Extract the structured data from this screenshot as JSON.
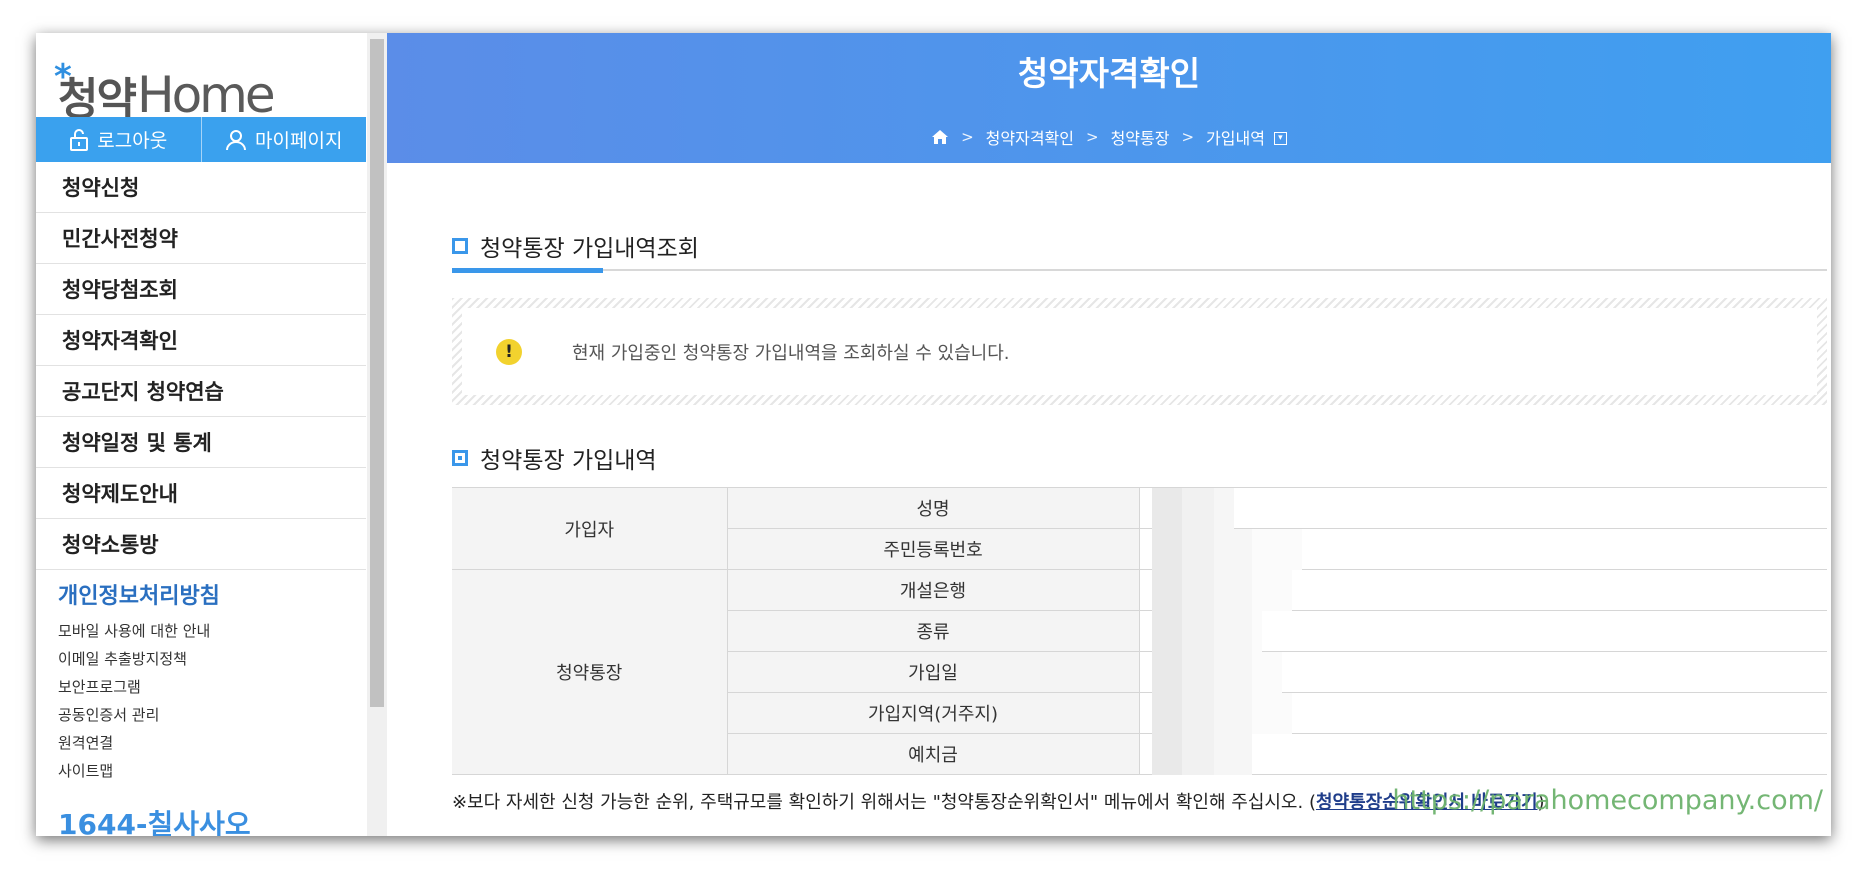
{
  "logo": {
    "korean": "청약",
    "english": "Home"
  },
  "auth": {
    "logout_label": "로그아웃",
    "mypage_label": "마이페이지"
  },
  "menu": {
    "items": [
      {
        "label": "청약신청"
      },
      {
        "label": "민간사전청약"
      },
      {
        "label": "청약당첨조회"
      },
      {
        "label": "청약자격확인"
      },
      {
        "label": "공고단지 청약연습"
      },
      {
        "label": "청약일정 및 통계"
      },
      {
        "label": "청약제도안내"
      },
      {
        "label": "청약소통방"
      }
    ]
  },
  "privacy": {
    "title": "개인정보처리방침"
  },
  "sub_links": [
    {
      "label": "모바일 사용에 대한 안내"
    },
    {
      "label": "이메일 추출방지정책"
    },
    {
      "label": "보안프로그램"
    },
    {
      "label": "공동인증서 관리"
    },
    {
      "label": "원격연결"
    },
    {
      "label": "사이트맵"
    }
  ],
  "phone": "1644-칠사사오",
  "banner": {
    "title": "청약자격확인",
    "breadcrumb": [
      "청약자격확인",
      "청약통장",
      "가입내역"
    ]
  },
  "section1": {
    "title": "청약통장 가입내역조회"
  },
  "notice": {
    "text": "현재 가입중인 청약통장 가입내역을 조회하실 수 있습니다."
  },
  "section2": {
    "title": "청약통장 가입내역"
  },
  "table": {
    "group1": "가입자",
    "group2": "청약통장",
    "fields": [
      "성명",
      "주민등록번호",
      "개설은행",
      "종류",
      "가입일",
      "가입지역(거주지)",
      "예치금"
    ]
  },
  "footnote": {
    "text": "※보다 자세한 신청 가능한 순위, 주택규모를 확인하기 위해서는 \"청약통장순위확인서\" 메뉴에서 확인해 주십시오. (",
    "link": "청약통장순위확인서 바로가기",
    "close": ")"
  },
  "watermark": "https://parahomecompany.com/",
  "colors": {
    "brand_blue": "#3a97ea",
    "banner_start": "#5b8de8",
    "banner_end": "#3f9ff0",
    "warning_yellow": "#f2d22e"
  }
}
